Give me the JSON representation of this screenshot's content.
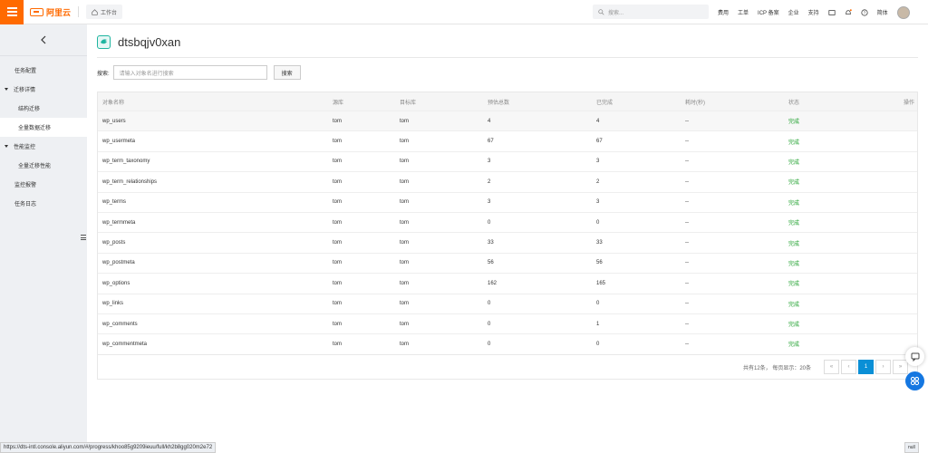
{
  "topbar": {
    "logo_text": "阿里云",
    "workbench": "工作台",
    "search_placeholder": "搜索...",
    "links": [
      "费用",
      "工单",
      "ICP 备案",
      "企业",
      "支持"
    ],
    "language": "简体"
  },
  "sidebar": {
    "items": [
      {
        "label": "任务配置",
        "type": "top"
      },
      {
        "label": "迁移详情",
        "type": "group"
      },
      {
        "label": "结构迁移",
        "type": "sub"
      },
      {
        "label": "全量数据迁移",
        "type": "sub-active"
      },
      {
        "label": "性能监控",
        "type": "group"
      },
      {
        "label": "全量迁移性能",
        "type": "sub"
      },
      {
        "label": "监控报警",
        "type": "top"
      },
      {
        "label": "任务日志",
        "type": "top"
      }
    ]
  },
  "main": {
    "title": "dtsbqjv0xan",
    "search_label": "搜索:",
    "search_placeholder": "请输入对象名进行搜索",
    "search_button": "搜索"
  },
  "table": {
    "headers": [
      "对象名称",
      "源库",
      "目标库",
      "预估总数",
      "已完成",
      "耗时(秒)",
      "状态",
      "操作"
    ],
    "rows": [
      [
        "wp_users",
        "tom",
        "tom",
        "4",
        "4",
        "--",
        "完成"
      ],
      [
        "wp_usermeta",
        "tom",
        "tom",
        "67",
        "67",
        "--",
        "完成"
      ],
      [
        "wp_term_taxonomy",
        "tom",
        "tom",
        "3",
        "3",
        "--",
        "完成"
      ],
      [
        "wp_term_relationships",
        "tom",
        "tom",
        "2",
        "2",
        "--",
        "完成"
      ],
      [
        "wp_terms",
        "tom",
        "tom",
        "3",
        "3",
        "--",
        "完成"
      ],
      [
        "wp_termmeta",
        "tom",
        "tom",
        "0",
        "0",
        "--",
        "完成"
      ],
      [
        "wp_posts",
        "tom",
        "tom",
        "33",
        "33",
        "--",
        "完成"
      ],
      [
        "wp_postmeta",
        "tom",
        "tom",
        "56",
        "56",
        "--",
        "完成"
      ],
      [
        "wp_options",
        "tom",
        "tom",
        "162",
        "165",
        "--",
        "完成"
      ],
      [
        "wp_links",
        "tom",
        "tom",
        "0",
        "0",
        "--",
        "完成"
      ],
      [
        "wp_comments",
        "tom",
        "tom",
        "0",
        "1",
        "--",
        "完成"
      ],
      [
        "wp_commentmeta",
        "tom",
        "tom",
        "0",
        "0",
        "--",
        "完成"
      ]
    ]
  },
  "pagination": {
    "info": "共有12条， 每页显示：20条",
    "first": "«",
    "prev": "‹",
    "current": "1",
    "next": "›",
    "last": "»"
  },
  "statusbar": {
    "url": "https://dts-intl.console.aliyun.com/#/progress/khoo85g9209ieuu/full/kh2b8gg020m2e72",
    "null_tag": "null"
  },
  "colors": {
    "brand": "#ff6a00",
    "success": "#1a9f29",
    "accent": "#0a8fd6"
  }
}
